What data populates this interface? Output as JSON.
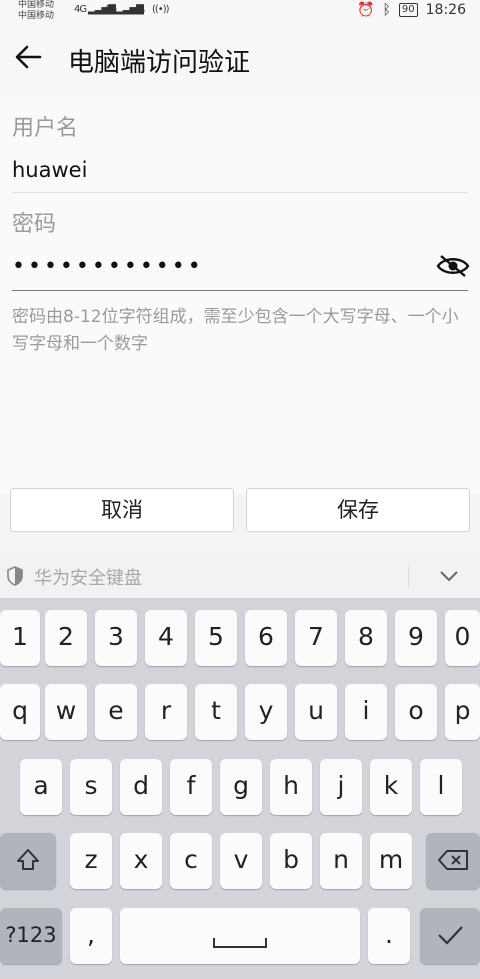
{
  "status_bar": {
    "carrier_1": "中国移动",
    "carrier_2": "中国移动",
    "network_1": "4G",
    "network_2": "4G",
    "battery": "90",
    "time": "18:26"
  },
  "header": {
    "title": "电脑端访问验证"
  },
  "form": {
    "username_label": "用户名",
    "username_value": "huawei",
    "password_label": "密码",
    "password_masked": "••••••••••••",
    "hint": "密码由8-12位字符组成，需至少包含一个大写字母、一个小写字母和一个数字"
  },
  "actions": {
    "cancel": "取消",
    "save": "保存"
  },
  "keyboard": {
    "title": "华为安全键盘",
    "row_numbers": [
      "1",
      "2",
      "3",
      "4",
      "5",
      "6",
      "7",
      "8",
      "9",
      "0"
    ],
    "row_1": [
      "q",
      "w",
      "e",
      "r",
      "t",
      "y",
      "u",
      "i",
      "o",
      "p"
    ],
    "row_2": [
      "a",
      "s",
      "d",
      "f",
      "g",
      "h",
      "j",
      "k",
      "l"
    ],
    "row_3": [
      "z",
      "x",
      "c",
      "v",
      "b",
      "n",
      "m"
    ],
    "symbols_key": "?123",
    "comma_key": ",",
    "period_key": ".",
    "icons": [
      "shield-icon",
      "chevron-down-icon",
      "shift-icon",
      "backspace-icon",
      "space-icon",
      "done-check-icon"
    ]
  }
}
